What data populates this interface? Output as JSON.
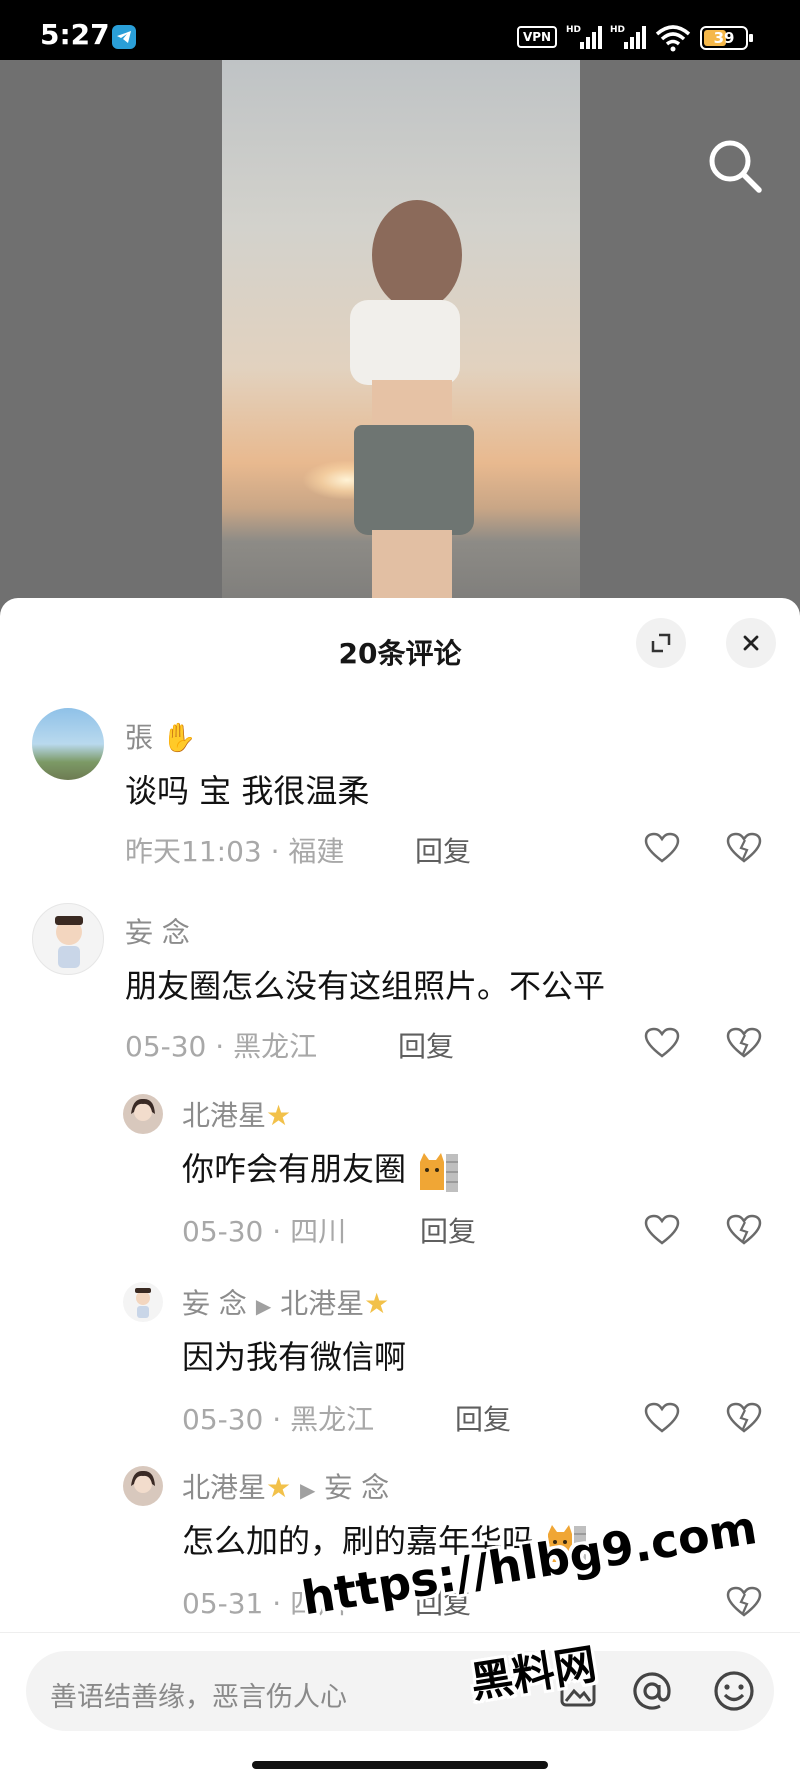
{
  "status_bar": {
    "time": "5:27",
    "vpn": "VPN",
    "battery": "39",
    "signal_label": "HD"
  },
  "sheet": {
    "title": "20条评论"
  },
  "comments": [
    {
      "name": "張",
      "text": "谈吗 宝 我很温柔",
      "date": "昨天11:03",
      "location": "福建",
      "reply": "回复"
    },
    {
      "name": "妄 念",
      "text": "朋友圈怎么没有这组照片。不公平",
      "date": "05-30",
      "location": "黑龙江",
      "reply": "回复"
    },
    {
      "name": "北港星",
      "text": "你咋会有朋友圈",
      "date": "05-30",
      "location": "四川",
      "reply": "回复"
    },
    {
      "name": "妄 念",
      "reply_to": "北港星",
      "text": "因为我有微信啊",
      "date": "05-30",
      "location": "黑龙江",
      "reply": "回复"
    },
    {
      "name": "北港星",
      "reply_to": "妄 念",
      "text": "怎么加的，刷的嘉年华吗",
      "date": "05-31",
      "location": "四川",
      "reply": "回复"
    }
  ],
  "separator": "·",
  "input": {
    "placeholder": "善语结善缘，恶言伤人心"
  },
  "watermark": {
    "url": "https://hlbg9.com",
    "name": "黑料网"
  },
  "colors": {
    "accent_star": "#f2c14a",
    "telegram": "#2a9fd8",
    "battery": "#f5b84a"
  }
}
